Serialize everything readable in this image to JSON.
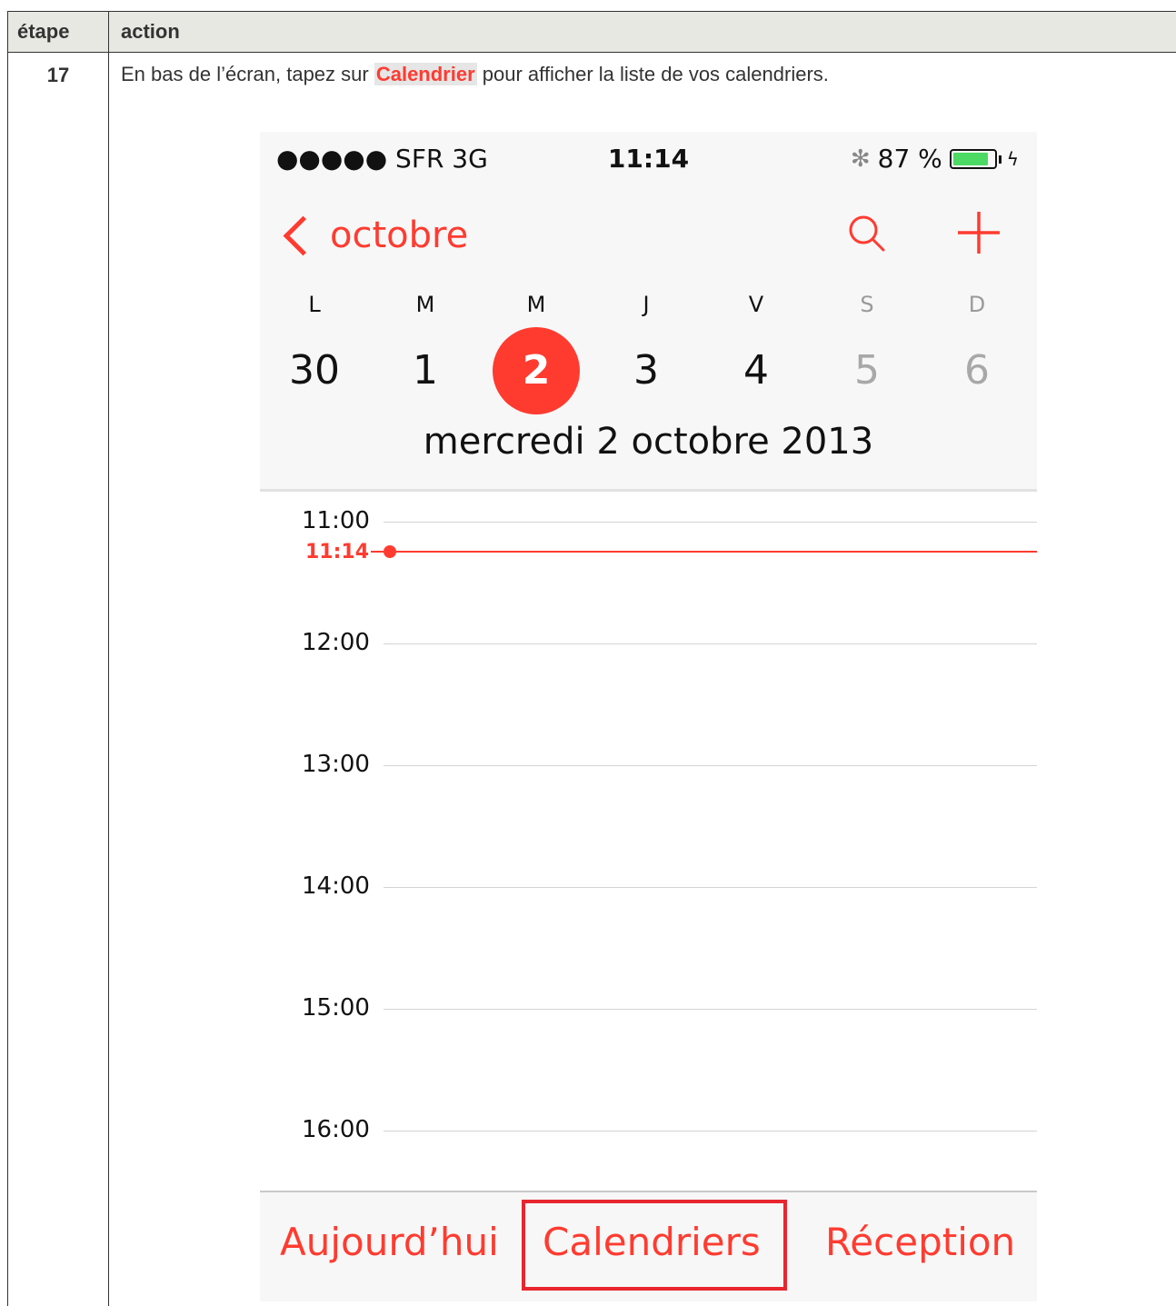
{
  "table": {
    "header_step": "étape",
    "header_action": "action",
    "step_number": "17",
    "instruction_before": "En bas de l’écran, tapez sur ",
    "instruction_keyword": "Calendrier",
    "instruction_after": " pour afficher la liste de vos calendriers."
  },
  "status_bar": {
    "carrier": "●●●●● SFR   3G",
    "time": "11:14",
    "battery_text": "87 %",
    "battery_level": 0.87,
    "bluetooth_icon": "bluetooth-icon",
    "charging_icon": "bolt-icon"
  },
  "nav": {
    "back_label": "octobre",
    "search_icon": "search-icon",
    "add_icon": "plus-icon"
  },
  "week": {
    "days": [
      "L",
      "M",
      "M",
      "J",
      "V",
      "S",
      "D"
    ],
    "dates": [
      "30",
      "1",
      "2",
      "3",
      "4",
      "5",
      "6"
    ],
    "selected_index": 2,
    "selected_date_title": "mercredi  2 octobre 2013"
  },
  "timeline": {
    "hours": [
      "11:00",
      "12:00",
      "13:00",
      "14:00",
      "15:00",
      "16:00"
    ],
    "now_label": "11:14"
  },
  "tabbar": {
    "today": "Aujourd’hui",
    "calendars": "Calendriers",
    "inbox": "Réception"
  },
  "colors": {
    "accent": "#ff3b30",
    "highlight_border": "#e8262f",
    "header_bg": "#e8e8e3",
    "battery_green": "#4cd964"
  }
}
